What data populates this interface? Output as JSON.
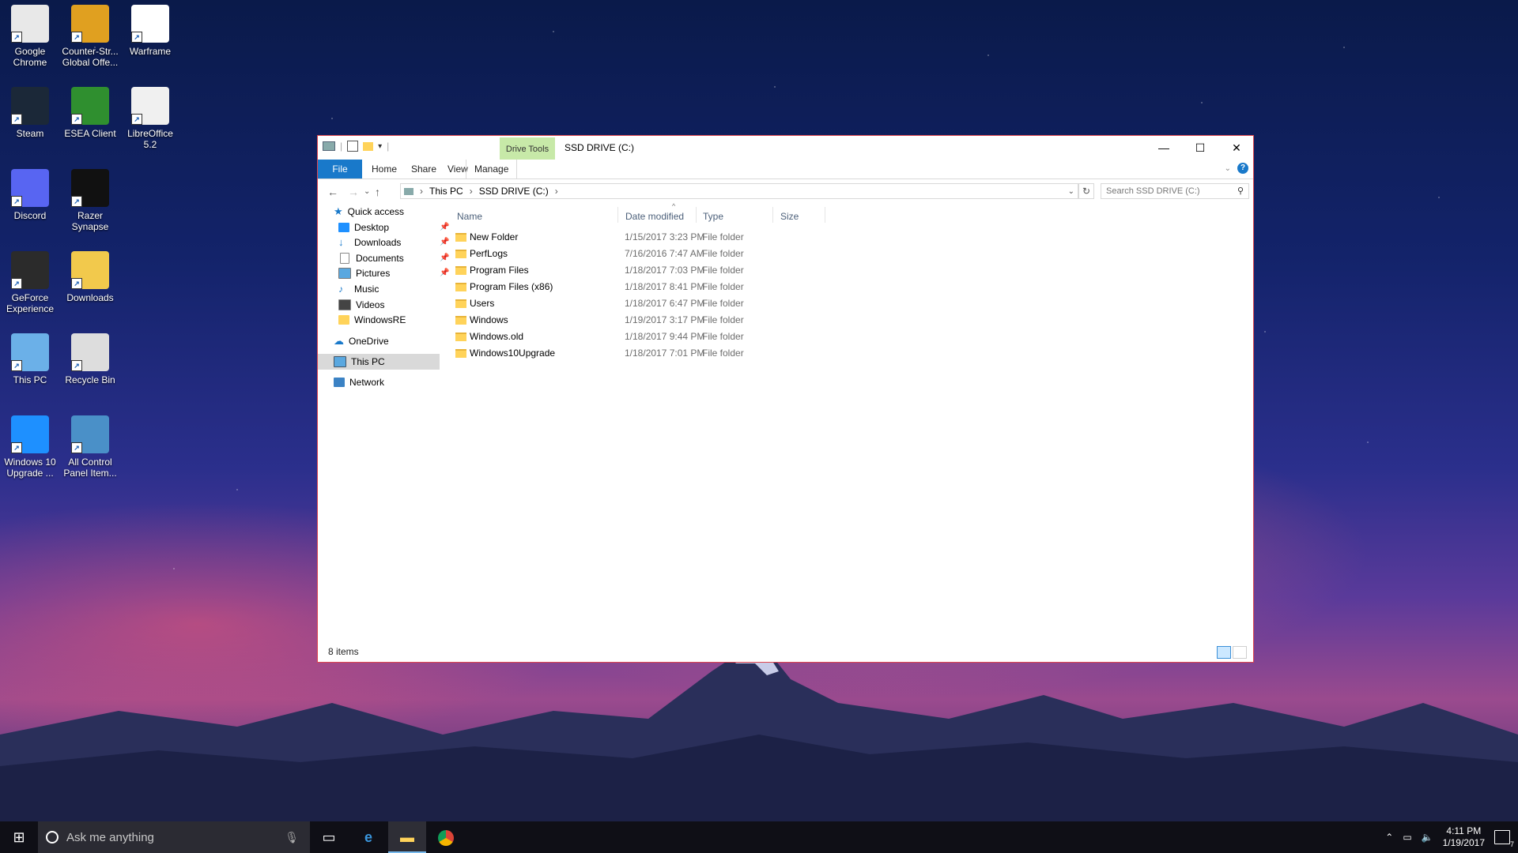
{
  "desktop": {
    "icons": [
      {
        "label": "Google Chrome",
        "icon": "chrome-icon"
      },
      {
        "label": "Counter-Str... Global Offe...",
        "icon": "csgo-icon"
      },
      {
        "label": "Warframe",
        "icon": "warframe-icon"
      },
      {
        "label": "Steam",
        "icon": "steam-icon"
      },
      {
        "label": "ESEA Client",
        "icon": "esea-icon"
      },
      {
        "label": "LibreOffice 5.2",
        "icon": "libreoffice-icon"
      },
      {
        "label": "Discord",
        "icon": "discord-icon"
      },
      {
        "label": "Razer Synapse",
        "icon": "razer-icon"
      },
      {
        "label": "GeForce Experience",
        "icon": "geforce-icon"
      },
      {
        "label": "Downloads",
        "icon": "downloads-folder-icon"
      },
      {
        "label": "This PC",
        "icon": "computer-icon"
      },
      {
        "label": "Recycle Bin",
        "icon": "recycle-bin-icon"
      },
      {
        "label": "Windows 10 Upgrade ...",
        "icon": "windows-icon"
      },
      {
        "label": "All Control Panel Item...",
        "icon": "control-panel-icon"
      }
    ]
  },
  "window": {
    "title": "SSD DRIVE (C:)",
    "context_tab": "Drive Tools",
    "ribbon_tabs": [
      "File",
      "Home",
      "Share",
      "View",
      "Manage"
    ],
    "breadcrumb": [
      "This PC",
      "SSD DRIVE (C:)"
    ],
    "search_placeholder": "Search SSD DRIVE (C:)",
    "nav": {
      "quick_access": "Quick access",
      "pinned": [
        "Desktop",
        "Downloads",
        "Documents",
        "Pictures"
      ],
      "unpinned": [
        "Music",
        "Videos",
        "WindowsRE"
      ],
      "onedrive": "OneDrive",
      "this_pc": "This PC",
      "network": "Network"
    },
    "columns": [
      "Name",
      "Date modified",
      "Type",
      "Size"
    ],
    "files": [
      {
        "name": "New Folder",
        "date": "1/15/2017 3:23 PM",
        "type": "File folder"
      },
      {
        "name": "PerfLogs",
        "date": "7/16/2016 7:47 AM",
        "type": "File folder"
      },
      {
        "name": "Program Files",
        "date": "1/18/2017 7:03 PM",
        "type": "File folder"
      },
      {
        "name": "Program Files (x86)",
        "date": "1/18/2017 8:41 PM",
        "type": "File folder"
      },
      {
        "name": "Users",
        "date": "1/18/2017 6:47 PM",
        "type": "File folder"
      },
      {
        "name": "Windows",
        "date": "1/19/2017 3:17 PM",
        "type": "File folder"
      },
      {
        "name": "Windows.old",
        "date": "1/18/2017 9:44 PM",
        "type": "File folder"
      },
      {
        "name": "Windows10Upgrade",
        "date": "1/18/2017 7:01 PM",
        "type": "File folder"
      }
    ],
    "status": "8 items"
  },
  "taskbar": {
    "search_placeholder": "Ask me anything",
    "time": "4:11 PM",
    "date": "1/19/2017",
    "notifications": "7"
  },
  "colors": {
    "accent": "#1979ca",
    "drive_tools": "#c7e9a8",
    "window_border": "#e0474f"
  }
}
